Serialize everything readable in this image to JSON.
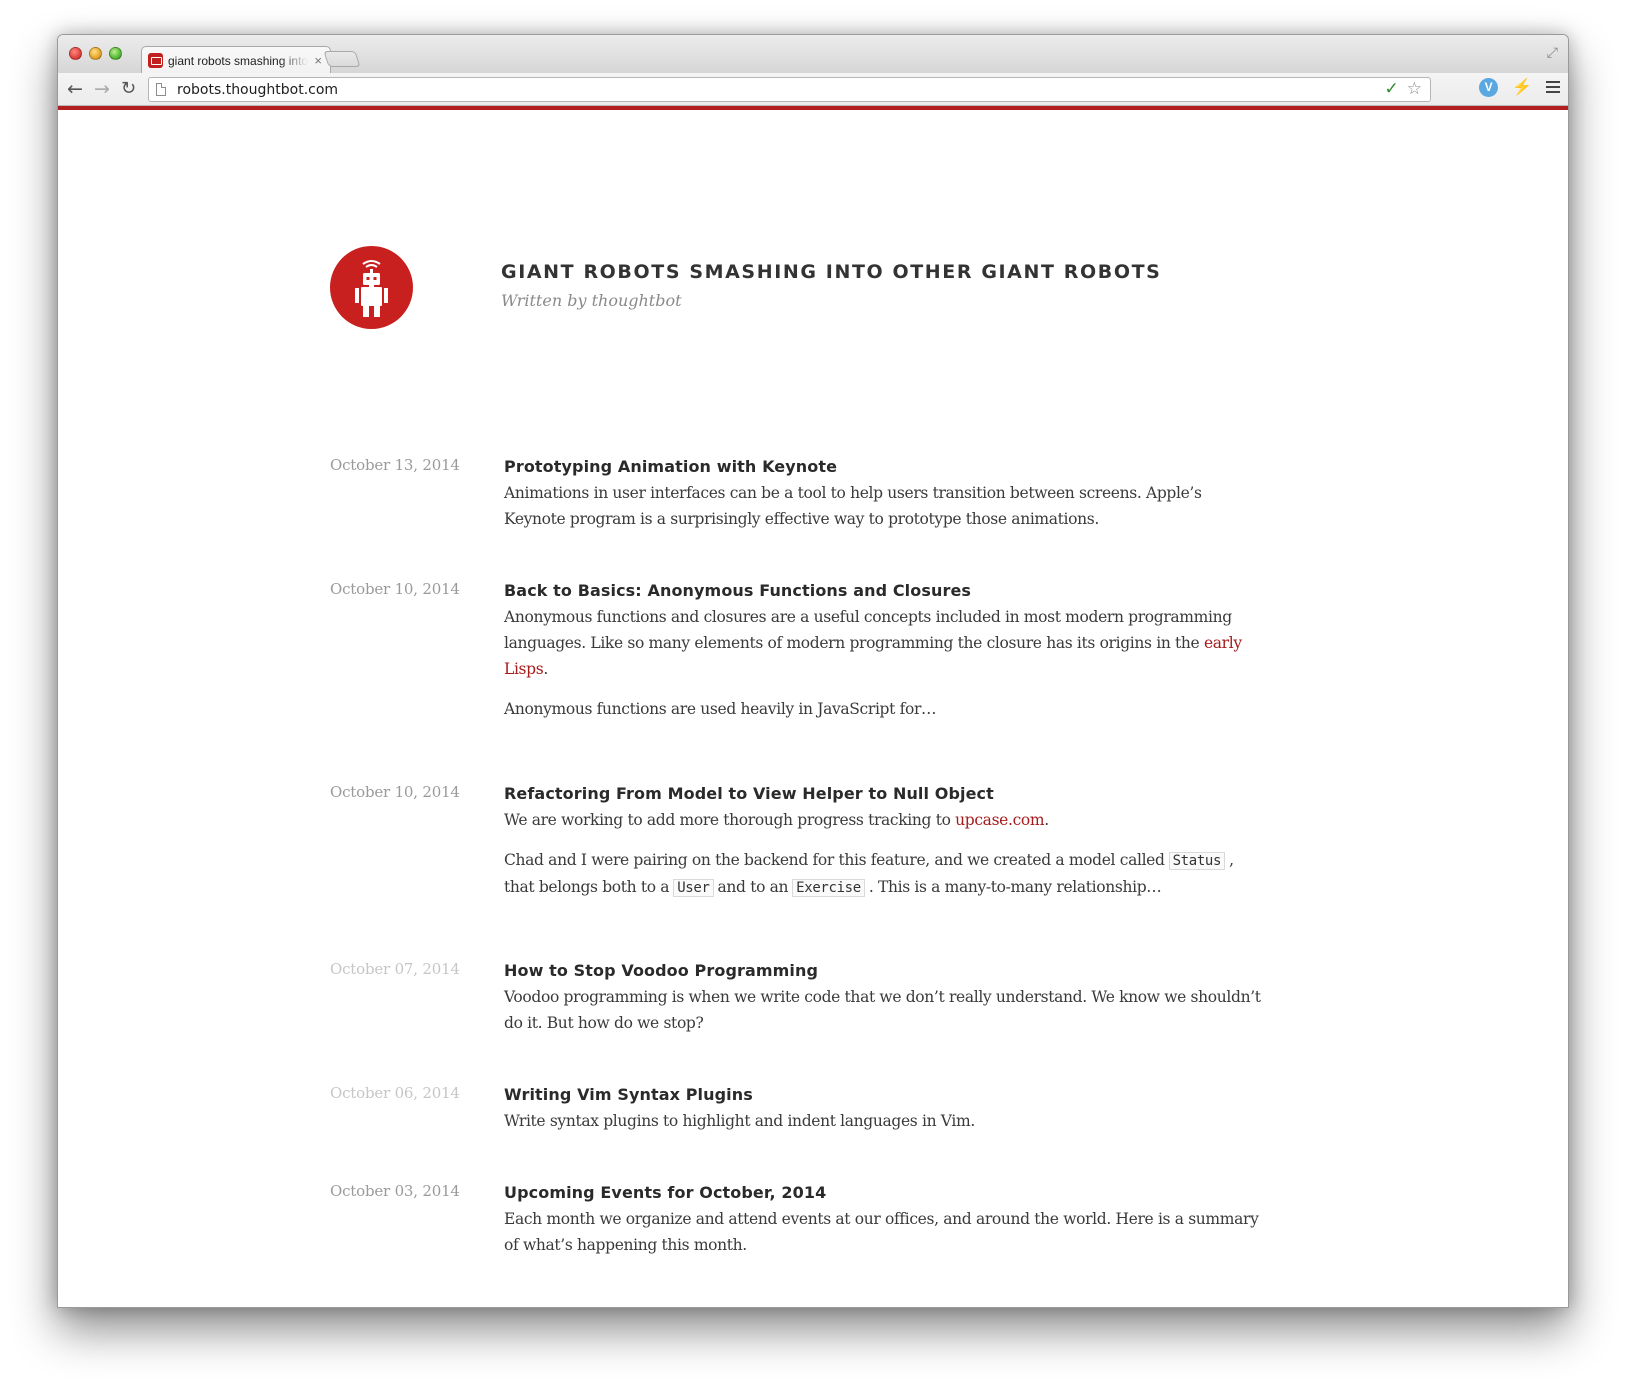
{
  "browser": {
    "tab_title": "giant robots smashing into other giant robots",
    "tab_close": "×",
    "url": "robots.thoughtbot.com",
    "icons": [
      "back-icon",
      "forward-icon",
      "reload-icon",
      "page-icon",
      "spell-check-icon",
      "star-icon",
      "extension-icon",
      "extension-icon",
      "menu-icon",
      "fullscreen-icon"
    ],
    "accent_color": "#b11f1f"
  },
  "blog": {
    "title": "GIANT ROBOTS SMASHING INTO OTHER GIANT ROBOTS",
    "subtitle": "Written by thoughtbot",
    "logo_icon": "robot-icon",
    "brand_color": "#c81f1f"
  },
  "posts": [
    {
      "date": "October 13, 2014",
      "title": "Prototyping Animation with Keynote",
      "p1": "Animations in user interfaces can be a tool to help users transition between screens. Apple’s Keynote program is a surprisingly effective way to prototype those animations."
    },
    {
      "date": "October 10, 2014",
      "title": "Back to Basics: Anonymous Functions and Closures",
      "p1_a": "Anonymous functions and closures are a useful concepts included in most modern programming languages. Like so many elements of modern programming the closure has its origins in the ",
      "p1_link": "early Lisps",
      "p1_b": ".",
      "p2": "Anonymous functions are used heavily in JavaScript for…"
    },
    {
      "date": "October 10, 2014",
      "title": "Refactoring From Model to View Helper to Null Object",
      "p1_a": "We are working to add more thorough progress tracking to ",
      "p1_link": "upcase.com",
      "p1_b": ".",
      "p2_a": "Chad and I were pairing on the backend for this feature, and we created a model called",
      "code1": "Status",
      "p2_b": ", that belongs both to a",
      "code2": "User",
      "p2_c": "and to an",
      "code3": "Exercise",
      "p2_d": ". This is a many-to-many relationship…"
    },
    {
      "date": "October 07, 2014",
      "title": "How to Stop Voodoo Programming",
      "p1": "Voodoo programming is when we write code that we don’t really understand. We know we shouldn’t do it. But how do we stop?"
    },
    {
      "date": "October 06, 2014",
      "title": "Writing Vim Syntax Plugins",
      "p1": "Write syntax plugins to highlight and indent languages in Vim."
    },
    {
      "date": "October 03, 2014",
      "title": "Upcoming Events for October, 2014",
      "p1": "Each month we organize and attend events at our offices, and around the world. Here is a summary of what’s happening this month."
    }
  ]
}
